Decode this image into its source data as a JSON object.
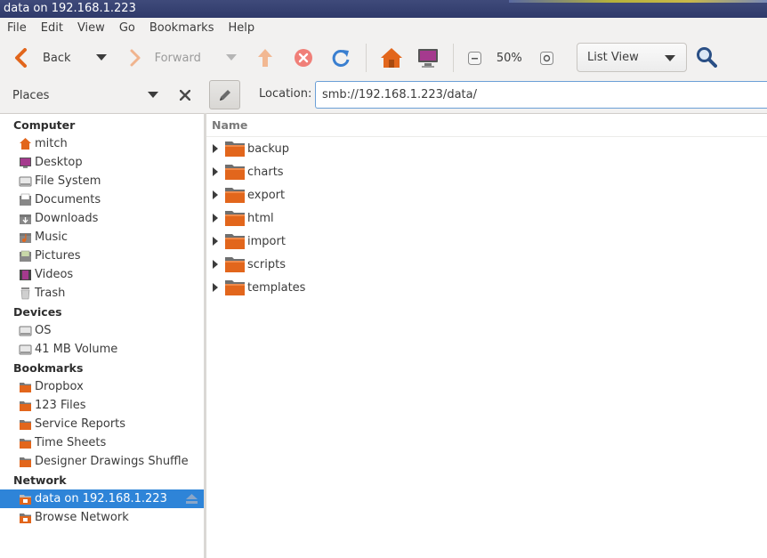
{
  "window": {
    "title": "data on 192.168.1.223"
  },
  "menubar": {
    "items": [
      "File",
      "Edit",
      "View",
      "Go",
      "Bookmarks",
      "Help"
    ]
  },
  "toolbar": {
    "back_label": "Back",
    "forward_label": "Forward",
    "zoom_level": "50%",
    "view_mode": "List View"
  },
  "sidebar": {
    "header": "Places",
    "sections": [
      {
        "title": "Computer",
        "items": [
          {
            "label": "mitch",
            "icon": "home-icon"
          },
          {
            "label": "Desktop",
            "icon": "desktop-icon"
          },
          {
            "label": "File System",
            "icon": "drive-icon"
          },
          {
            "label": "Documents",
            "icon": "documents-folder-icon"
          },
          {
            "label": "Downloads",
            "icon": "downloads-folder-icon"
          },
          {
            "label": "Music",
            "icon": "music-folder-icon"
          },
          {
            "label": "Pictures",
            "icon": "pictures-folder-icon"
          },
          {
            "label": "Videos",
            "icon": "videos-folder-icon"
          },
          {
            "label": "Trash",
            "icon": "trash-icon"
          }
        ]
      },
      {
        "title": "Devices",
        "items": [
          {
            "label": "OS",
            "icon": "drive-icon"
          },
          {
            "label": "41 MB Volume",
            "icon": "drive-icon"
          }
        ]
      },
      {
        "title": "Bookmarks",
        "items": [
          {
            "label": "Dropbox",
            "icon": "folder-icon"
          },
          {
            "label": "123 Files",
            "icon": "folder-icon"
          },
          {
            "label": "Service Reports",
            "icon": "folder-icon"
          },
          {
            "label": "Time Sheets",
            "icon": "folder-icon"
          },
          {
            "label": "Designer Drawings Shuffle",
            "icon": "folder-icon"
          }
        ]
      },
      {
        "title": "Network",
        "items": [
          {
            "label": "data on 192.168.1.223",
            "icon": "network-share-icon",
            "selected": true
          },
          {
            "label": "Browse Network",
            "icon": "network-icon"
          }
        ]
      }
    ]
  },
  "location": {
    "label": "Location:",
    "value": "smb://192.168.1.223/data/"
  },
  "file_list": {
    "column_name": "Name",
    "folders": [
      "backup",
      "charts",
      "export",
      "html",
      "import",
      "scripts",
      "templates"
    ]
  },
  "colors": {
    "selection": "#2e84d8",
    "folder": "#e2661c",
    "accent_border": "#6b9fd6"
  }
}
